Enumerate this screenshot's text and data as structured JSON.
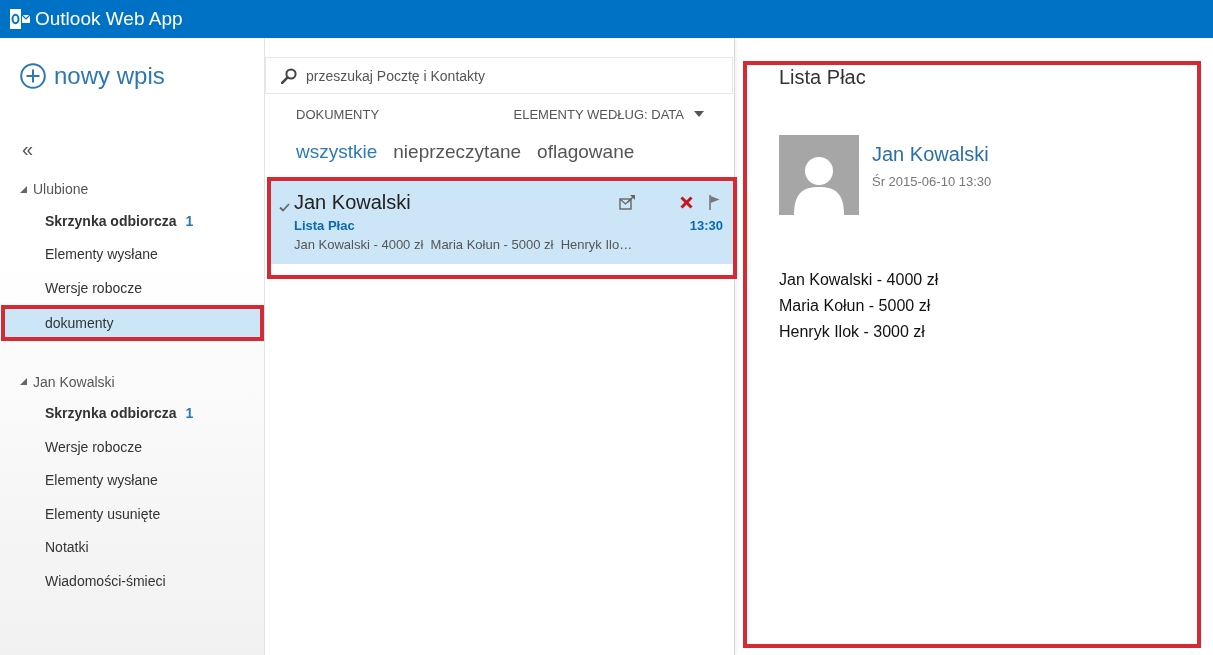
{
  "app_bar": {
    "title": "Outlook Web App"
  },
  "sidebar": {
    "new_button": {
      "label": "nowy wpis"
    },
    "collapse_button": {
      "label": "«"
    },
    "groups": [
      {
        "label": "Ulubione",
        "expanded": true,
        "children": [
          {
            "label": "Skrzynka odbiorcza",
            "count": "1",
            "unread": true,
            "selected": false,
            "highlighted": false
          },
          {
            "label": "Elementy wysłane",
            "unread": false,
            "selected": false,
            "highlighted": false
          },
          {
            "label": "Wersje robocze",
            "unread": false,
            "selected": false,
            "highlighted": false
          },
          {
            "label": "dokumenty",
            "unread": false,
            "selected": true,
            "highlighted": true
          }
        ]
      },
      {
        "label": "Jan Kowalski",
        "expanded": true,
        "children": [
          {
            "label": "Skrzynka odbiorcza",
            "count": "1",
            "unread": true,
            "selected": false,
            "highlighted": false
          },
          {
            "label": "Wersje robocze",
            "unread": false,
            "selected": false,
            "highlighted": false
          },
          {
            "label": "Elementy wysłane",
            "unread": false,
            "selected": false,
            "highlighted": false
          },
          {
            "label": "Elementy usunięte",
            "unread": false,
            "selected": false,
            "highlighted": false
          },
          {
            "label": "Notatki",
            "unread": false,
            "selected": false,
            "highlighted": false
          },
          {
            "label": "Wiadomości-śmieci",
            "unread": false,
            "selected": false,
            "highlighted": false
          }
        ]
      }
    ]
  },
  "message_list": {
    "search": {
      "placeholder": "przeszukaj Pocztę i Kontakty"
    },
    "folder_title": "DOKUMENTY",
    "sort": {
      "label": "ELEMENTY WEDŁUG: DATA"
    },
    "filters": [
      {
        "label": "wszystkie",
        "selected": true
      },
      {
        "label": "nieprzeczytane",
        "selected": false
      },
      {
        "label": "oflagowane",
        "selected": false
      }
    ],
    "messages": [
      {
        "sender": "Jan Kowalski",
        "subject": "Lista Płac",
        "preview": "Jan Kowalski - 4000 zł  Maria Kołun - 5000 zł  Henryk Ilo…",
        "time": "13:30",
        "checked": true,
        "selected": true,
        "highlighted": true
      }
    ]
  },
  "reading_pane": {
    "subject": "Lista Płac",
    "sender": "Jan Kowalski",
    "date": "Śr 2015-06-10 13:30",
    "body": [
      "Jan Kowalski - 4000 zł",
      "Maria Kołun - 5000 zł",
      "Henryk Ilok - 3000 zł"
    ],
    "highlighted": true
  }
}
